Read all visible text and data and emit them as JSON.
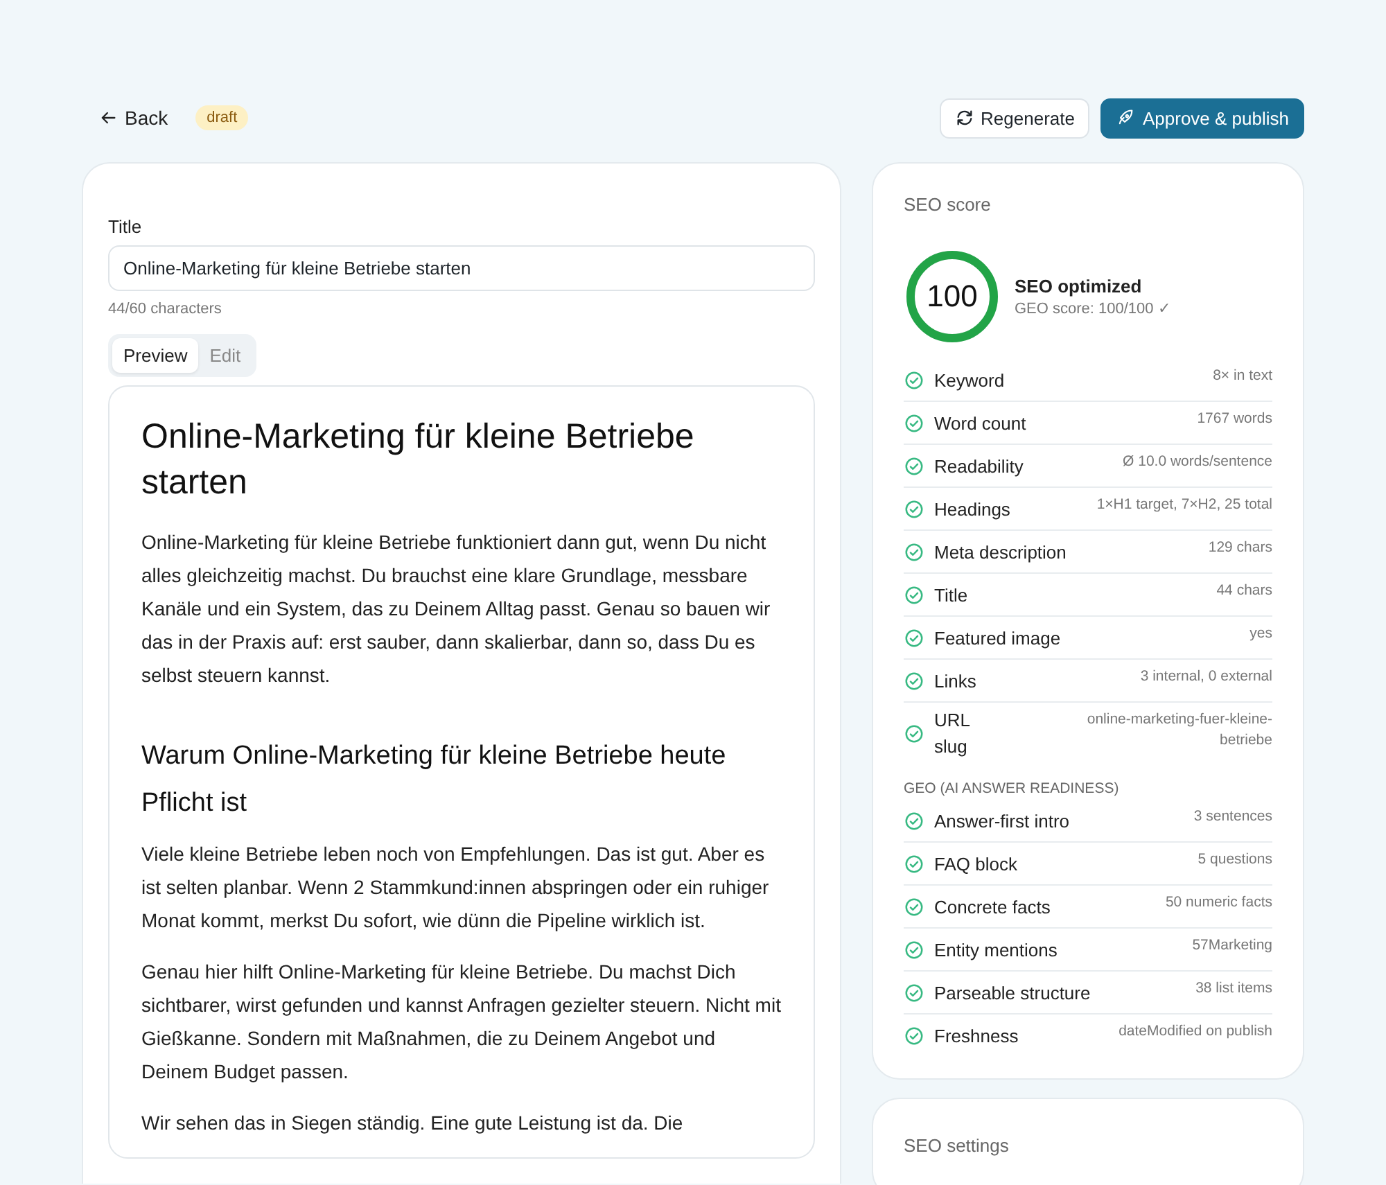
{
  "topbar": {
    "back": "Back",
    "status": "draft",
    "buttons": [
      {
        "kind": "secondary",
        "label": "Regenerate"
      },
      {
        "kind": "primary",
        "label": "Approve & publish"
      }
    ]
  },
  "editor": {
    "title_label": "Title",
    "title_value": "Online-Marketing für kleine Betriebe starten",
    "char_count": "44/60 characters",
    "tabs": [
      {
        "label": "Preview",
        "selected": true
      },
      {
        "label": "Edit",
        "selected": false
      }
    ],
    "content": [
      {
        "kind": "h1",
        "text": "Online-Marketing für kleine Betriebe starten"
      },
      {
        "kind": "p",
        "text": "Online-Marketing für kleine Betriebe funktioniert dann gut, wenn Du nicht alles gleichzeitig machst. Du brauchst eine klare Grundlage, messbare Kanäle und ein System, das zu Deinem Alltag passt. Genau so bauen wir das in der Praxis auf: erst sauber, dann skalierbar, dann so, dass Du es selbst steuern kannst."
      },
      {
        "kind": "h2",
        "text": "Warum Online-Marketing für kleine Betriebe heute Pflicht ist"
      },
      {
        "kind": "p",
        "text": "Viele kleine Betriebe leben noch von Empfehlungen. Das ist gut. Aber es ist selten planbar. Wenn 2 Stammkund:innen abspringen oder ein ruhiger Monat kommt, merkst Du sofort, wie dünn die Pipeline wirklich ist."
      },
      {
        "kind": "p",
        "text": "Genau hier hilft Online-Marketing für kleine Betriebe. Du machst Dich sichtbarer, wirst gefunden und kannst Anfragen gezielter steuern. Nicht mit Gießkanne. Sondern mit Maßnahmen, die zu Deinem Angebot und Deinem Budget passen."
      },
      {
        "kind": "p",
        "text": "Wir sehen das in Siegen ständig. Eine gute Leistung ist da. Die"
      }
    ]
  },
  "seo_score": {
    "heading": "SEO score",
    "score": "100",
    "level": 1,
    "status": "SEO optimized",
    "geo_score": "GEO score: 100/100 ✓",
    "checks": [
      {
        "label": "Keyword",
        "value": "8× in text",
        "passed": true
      },
      {
        "label": "Word count",
        "value": "1767 words",
        "passed": true
      },
      {
        "label": "Readability",
        "value": "Ø 10.0 words/sentence",
        "passed": true
      },
      {
        "label": "Headings",
        "value": "1×H1 target, 7×H2, 25 total",
        "passed": true
      },
      {
        "label": "Meta description",
        "value": "129 chars",
        "passed": true
      },
      {
        "label": "Title",
        "value": "44 chars",
        "passed": true
      },
      {
        "label": "Featured image",
        "value": "yes",
        "passed": true
      },
      {
        "label": "Links",
        "value": "3 internal, 0 external",
        "passed": true
      },
      {
        "label": "URL slug",
        "value": "online-marketing-fuer-kleine-betriebe",
        "passed": true
      }
    ],
    "geo_heading": "GEO (AI ANSWER READINESS)",
    "geo_checks": [
      {
        "label": "Answer-first intro",
        "value": "3 sentences",
        "passed": true
      },
      {
        "label": "FAQ block",
        "value": "5 questions",
        "passed": true
      },
      {
        "label": "Concrete facts",
        "value": "50 numeric facts",
        "passed": true
      },
      {
        "label": "Entity mentions",
        "value": "57Marketing",
        "passed": true
      },
      {
        "label": "Parseable structure",
        "value": "38 list items",
        "passed": true
      },
      {
        "label": "Freshness",
        "value": "dateModified on publish",
        "passed": true
      }
    ]
  },
  "seo_settings": {
    "heading": "SEO settings"
  }
}
